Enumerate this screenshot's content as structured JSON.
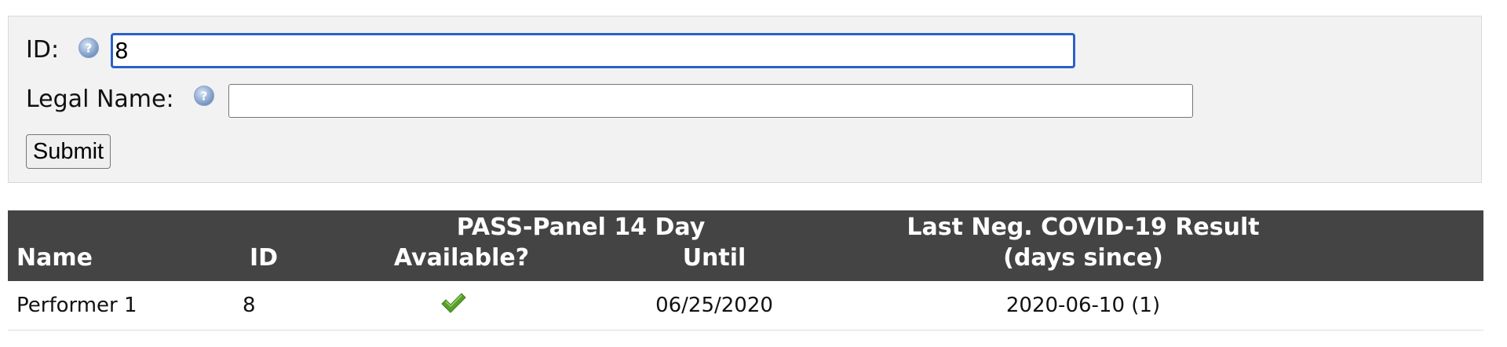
{
  "search_form": {
    "id_label": "ID:",
    "id_value": "8",
    "legal_name_label": "Legal Name:",
    "legal_name_value": "",
    "submit_label": "Submit"
  },
  "results": {
    "headers": {
      "name": "Name",
      "id": "ID",
      "pass_panel_group": "PASS-Panel 14 Day",
      "available": "Available?",
      "until": "Until",
      "covid_line1": "Last Neg. COVID-19 Result",
      "covid_line2": "(days since)"
    },
    "rows": [
      {
        "name": "Performer 1",
        "id": "8",
        "available_icon": "checkmark-icon",
        "until": "06/25/2020",
        "last_negative": "2020-06-10 (1)"
      }
    ]
  },
  "colors": {
    "header_bg": "#444444",
    "panel_bg": "#f2f2f2",
    "focus_border": "#2b61c6",
    "check_green": "#5aa02c"
  }
}
